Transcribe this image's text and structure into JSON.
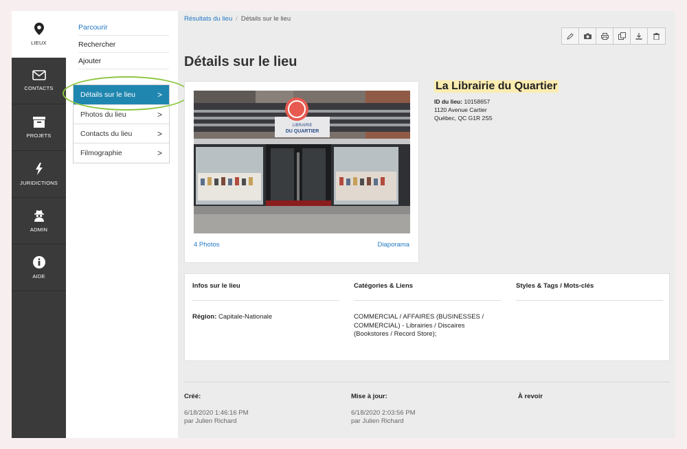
{
  "rail": {
    "items": [
      {
        "label": "LIEUX",
        "icon": "map-pin-icon"
      },
      {
        "label": "CONTACTS",
        "icon": "envelope-icon"
      },
      {
        "label": "PROJETS",
        "icon": "archive-icon"
      },
      {
        "label": "JURIDICTIONS",
        "icon": "bolt-icon"
      },
      {
        "label": "ADMIN",
        "icon": "user-secret-icon"
      },
      {
        "label": "AIDE",
        "icon": "info-icon"
      }
    ]
  },
  "nav": {
    "links": [
      "Parcourir",
      "Rechercher",
      "Ajouter"
    ],
    "submenu": [
      "Détails sur le lieu",
      "Photos du lieu",
      "Contacts du lieu",
      "Filmographie"
    ],
    "chevron": ">"
  },
  "breadcrumb": {
    "parent": "Résultats du lieu",
    "separator": "/",
    "current": "Détails sur le lieu"
  },
  "toolbar": [
    "pencil-icon",
    "camera-icon",
    "print-icon",
    "copy-icon",
    "download-icon",
    "trash-icon"
  ],
  "page": {
    "title": "Détails sur le lieu"
  },
  "photo": {
    "count_link": "4 Photos",
    "slideshow_link": "Diaporama",
    "sign_text_1": "LIBRAIRIE",
    "sign_text_2": "DU QUARTIER"
  },
  "place": {
    "name": "La Librairie du Quartier",
    "id_label": "ID du lieu:",
    "id_value": "10158657",
    "address_line1": "1120 Avenue Cartier",
    "address_line2": "Québec, QC G1R 2S5"
  },
  "details": {
    "col1_head": "Infos sur le lieu",
    "col2_head": "Catégories & Liens",
    "col3_head": "Styles & Tags / Mots-clés",
    "region_label": "Région:",
    "region_value": "Capitale-Nationale",
    "categories": "COMMERCIAL / AFFAIRES (BUSINESSES / COMMERCIAL) - Librairies / Discaires (Bookstores / Record Store);"
  },
  "meta": {
    "created_label": "Créé:",
    "created_date": "6/18/2020 1:46:16 PM",
    "created_by": "par Julien Richard",
    "updated_label": "Mise à jour:",
    "updated_date": "6/18/2020 2:03:56 PM",
    "updated_by": "par Julien Richard",
    "review_label": "À revoir"
  },
  "colors": {
    "accent": "#1f86b0",
    "link": "#2277c4",
    "highlight": "#fbecb0",
    "annotation": "#8cc63f",
    "rail": "#3a3a3a"
  }
}
